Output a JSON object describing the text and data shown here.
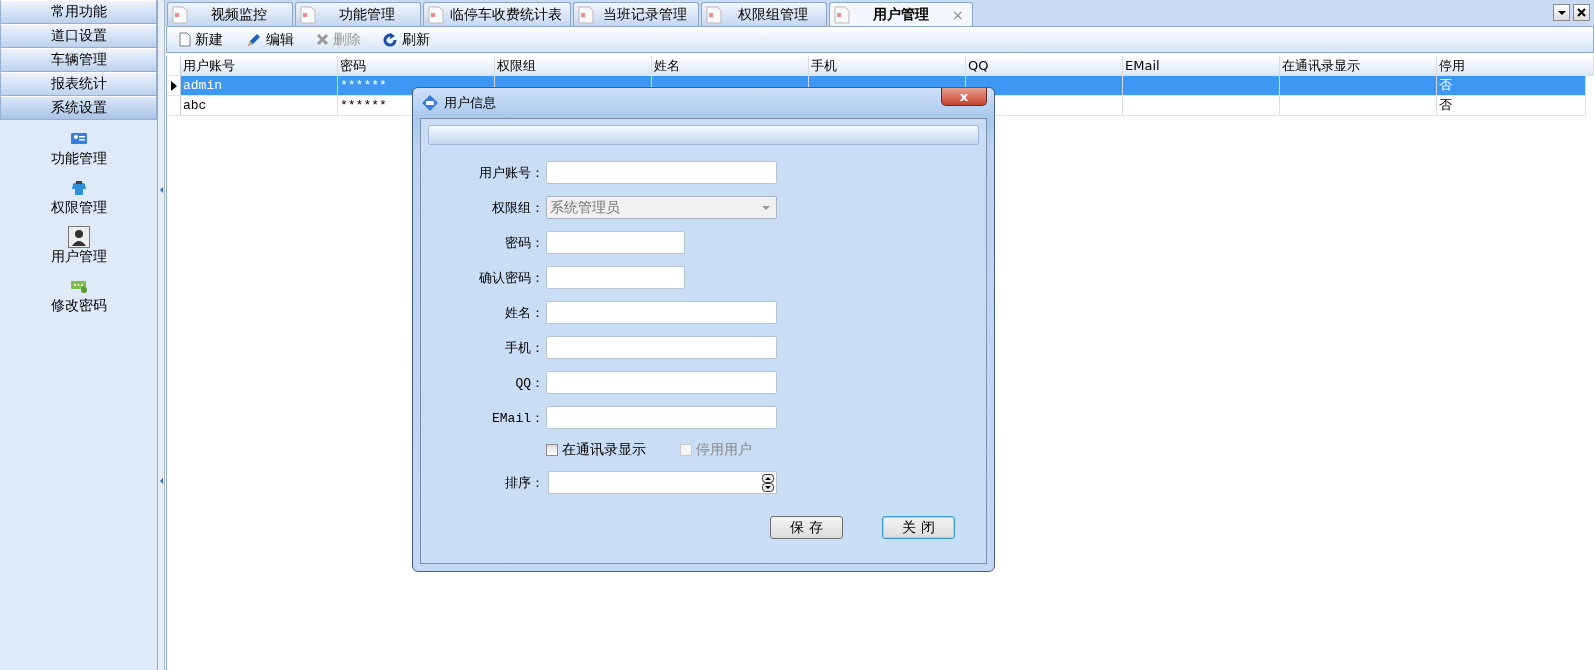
{
  "sidebar": {
    "sections": [
      {
        "label": "常用功能",
        "expanded": false
      },
      {
        "label": "道口设置",
        "expanded": false
      },
      {
        "label": "车辆管理",
        "expanded": false
      },
      {
        "label": "报表统计",
        "expanded": false
      },
      {
        "label": "系统设置",
        "expanded": true
      }
    ],
    "items": [
      {
        "label": "功能管理",
        "kind": "card",
        "selected": false
      },
      {
        "label": "权限管理",
        "kind": "shirt",
        "selected": false
      },
      {
        "label": "用户管理",
        "kind": "person",
        "selected": true
      },
      {
        "label": "修改密码",
        "kind": "key",
        "selected": false
      }
    ]
  },
  "tabs": [
    {
      "label": "视频监控",
      "selected": false
    },
    {
      "label": "功能管理",
      "selected": false
    },
    {
      "label": "临停车收费统计表",
      "selected": false
    },
    {
      "label": "当班记录管理",
      "selected": false
    },
    {
      "label": "权限组管理",
      "selected": false
    },
    {
      "label": "用户管理",
      "selected": true,
      "close": "×"
    }
  ],
  "toolbar": [
    {
      "label": "新建",
      "kind": "new",
      "disabled": false
    },
    {
      "label": "编辑",
      "kind": "edit",
      "disabled": false
    },
    {
      "label": "删除",
      "kind": "delete",
      "disabled": true
    },
    {
      "label": "刷新",
      "kind": "refresh",
      "disabled": false
    }
  ],
  "table": {
    "columns": [
      "用户账号",
      "密码",
      "权限组",
      "姓名",
      "手机",
      "QQ",
      "EMail",
      "在通讯录显示",
      "停用"
    ],
    "rows": [
      {
        "selected": true,
        "cells": [
          "admin",
          "******",
          "",
          "",
          "",
          "",
          "",
          "",
          "否"
        ]
      },
      {
        "selected": false,
        "cells": [
          "abc",
          "******",
          "",
          "",
          "",
          "",
          "",
          "",
          "否"
        ]
      }
    ]
  },
  "dialog": {
    "title": "用户信息",
    "close": "x",
    "fields": [
      {
        "label": "用户账号：",
        "kind": "text"
      },
      {
        "label": "权限组：",
        "kind": "select",
        "value": "系统管理员",
        "disabled": true
      },
      {
        "label": "密码：",
        "kind": "short"
      },
      {
        "label": "确认密码：",
        "kind": "short"
      },
      {
        "label": "姓名：",
        "kind": "text"
      },
      {
        "label": "手机：",
        "kind": "text"
      },
      {
        "label": "QQ：",
        "kind": "text"
      },
      {
        "label": "EMail：",
        "kind": "text"
      }
    ],
    "checkboxes": [
      {
        "label": "在通讯录显示",
        "checked": false,
        "disabled": false
      },
      {
        "label": "停用用户",
        "checked": false,
        "disabled": true
      }
    ],
    "order": {
      "label": "排序：",
      "kind": "spin"
    },
    "buttons": [
      {
        "label": "保 存",
        "focused": false
      },
      {
        "label": "关 闭",
        "focused": true
      }
    ]
  }
}
